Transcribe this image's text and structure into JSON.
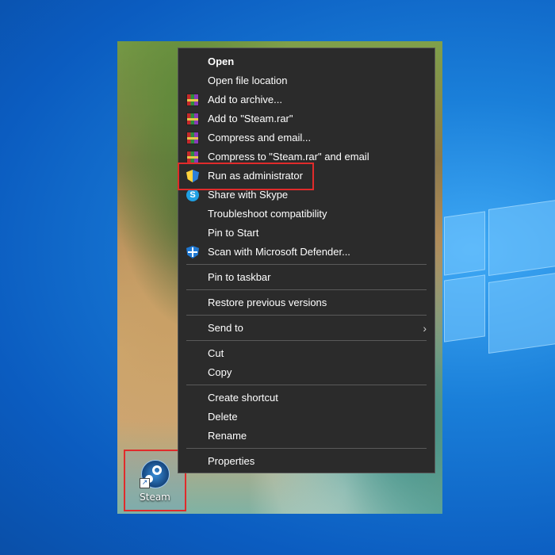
{
  "desktop": {
    "icon_label": "Steam",
    "icon_name": "steam-icon"
  },
  "menu": {
    "groups": [
      [
        {
          "label": "Open",
          "bold": true,
          "icon": null
        },
        {
          "label": "Open file location",
          "icon": null
        },
        {
          "label": "Add to archive...",
          "icon": "winrar-icon"
        },
        {
          "label": "Add to \"Steam.rar\"",
          "icon": "winrar-icon"
        },
        {
          "label": "Compress and email...",
          "icon": "winrar-icon"
        },
        {
          "label": "Compress to \"Steam.rar\" and email",
          "icon": "winrar-icon"
        },
        {
          "label": "Run as administrator",
          "icon": "uac-shield-icon"
        },
        {
          "label": "Share with Skype",
          "icon": "skype-icon"
        },
        {
          "label": "Troubleshoot compatibility",
          "icon": null
        },
        {
          "label": "Pin to Start",
          "icon": null
        },
        {
          "label": "Scan with Microsoft Defender...",
          "icon": "defender-icon"
        }
      ],
      [
        {
          "label": "Pin to taskbar"
        }
      ],
      [
        {
          "label": "Restore previous versions"
        }
      ],
      [
        {
          "label": "Send to",
          "submenu": true
        }
      ],
      [
        {
          "label": "Cut"
        },
        {
          "label": "Copy"
        }
      ],
      [
        {
          "label": "Create shortcut"
        },
        {
          "label": "Delete"
        },
        {
          "label": "Rename"
        }
      ],
      [
        {
          "label": "Properties"
        }
      ]
    ]
  },
  "colors": {
    "menu_bg": "#2b2b2b",
    "highlight_border": "#e02b2b",
    "desktop_bg": "#1a7fd9"
  }
}
